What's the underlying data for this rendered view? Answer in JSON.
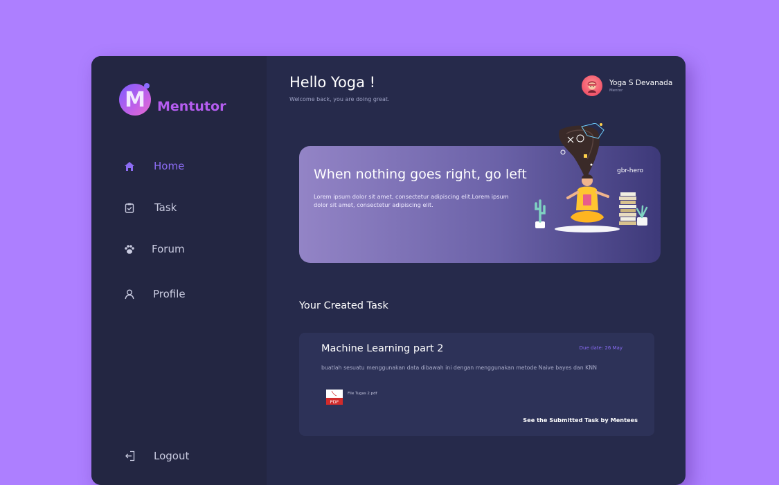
{
  "app": {
    "name": "Mentutor",
    "logo_letter": "M",
    "accent_color": "#8c6cf3",
    "background_color": "#ad7fff"
  },
  "sidebar": {
    "items": [
      {
        "label": "Home",
        "icon": "home-icon",
        "active": true
      },
      {
        "label": "Task",
        "icon": "clipboard-check-icon",
        "active": false
      },
      {
        "label": "Forum",
        "icon": "paw-icon",
        "active": false
      },
      {
        "label": "Profile",
        "icon": "user-icon",
        "active": false
      }
    ],
    "logout": {
      "label": "Logout",
      "icon": "logout-icon"
    }
  },
  "header": {
    "greeting": "Hello Yoga !",
    "subgreeting": "Welcome back, you are doing great."
  },
  "user": {
    "name": "Yoga S Devanada",
    "role": "Mentor"
  },
  "hero": {
    "title": "When nothing goes right, go left",
    "text": "Lorem ipsum dolor sit amet, consectetur adipiscing elit.Lorem ipsum dolor sit amet, consectetur adipiscing elit.",
    "image_alt": "gbr-hero"
  },
  "tasks_section": {
    "title": "Your Created Task",
    "tasks": [
      {
        "title": "Machine Learning part 2",
        "due": "Due date: 26 May",
        "description": "buatlah sesuatu menggunakan data dibawah ini dengan menggunakan metode Naive bayes dan KNN",
        "attachment": {
          "file_name": "File Tugas 2.pdf",
          "icon": "pdf-file-icon",
          "icon_text": "PDF"
        },
        "link": "See the Submitted Task by Mentees"
      }
    ]
  }
}
